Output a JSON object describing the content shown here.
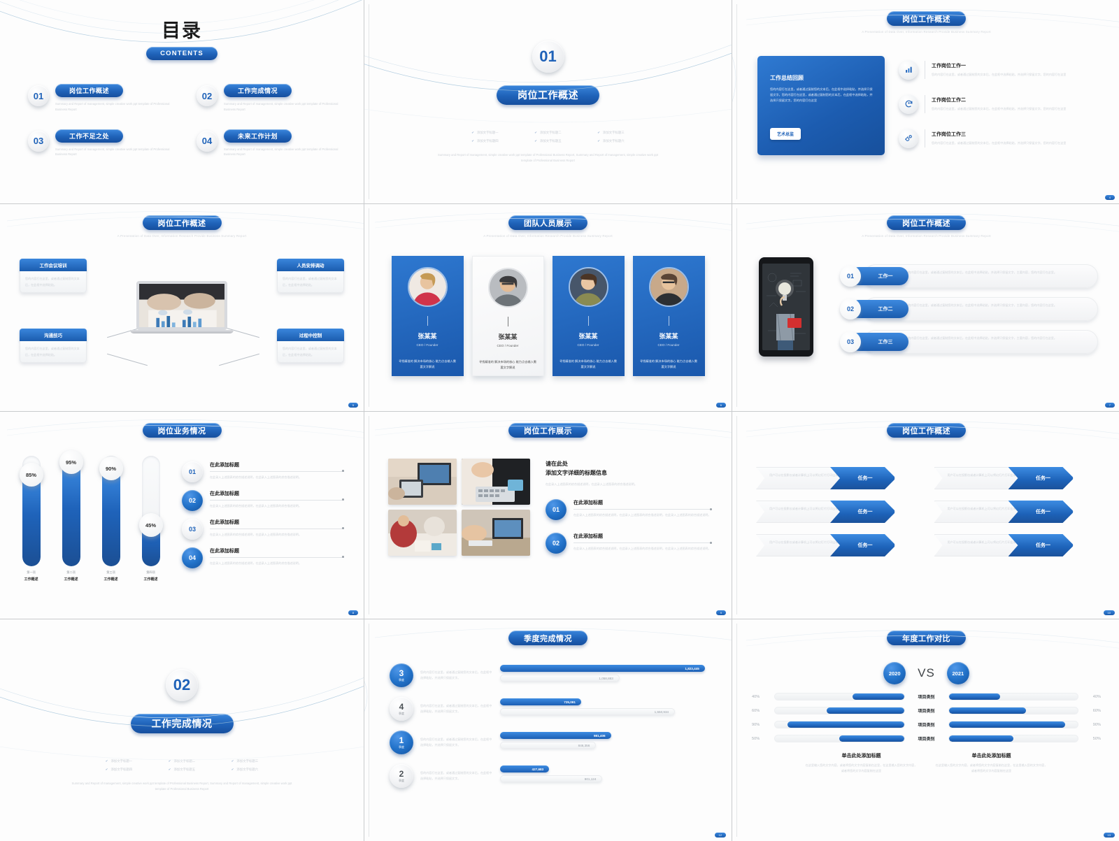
{
  "deck": {
    "accent_blue": "#1f62b8",
    "accent_blue_light": "#3d8ce2",
    "lorem_en": "Summary and Report of management, simple creative work ppt template of Professional Business Report",
    "lorem_cn_short": "您的内容打在这里，或者通过复制您的文本后，在此框中选择粘贴，并选择只保留文字。",
    "lorem_cn_long": "您的内容打在这里，或者通过复制您的文本后，在此框中选择粘贴，并选择只保留文字。您的内容打在这里，或者通过复制您的文本后，在此框中选择粘贴，并选择只保留文字。您的内容打在这里。",
    "lorem_cn_click": "在此录入上述图表的综合描述说明，在此录入上述图表的综合描述说明。",
    "sub_en_line": "A Presentation of Data Over, Information Research Provide Business Summary Report"
  },
  "slide1": {
    "title": "目录",
    "contents_label": "CONTENTS",
    "items": [
      {
        "num": "01",
        "label": "岗位工作概述"
      },
      {
        "num": "02",
        "label": "工作完成情况"
      },
      {
        "num": "03",
        "label": "工作不足之处"
      },
      {
        "num": "04",
        "label": "未来工作计划"
      }
    ]
  },
  "slide2": {
    "number": "01",
    "title": "岗位工作概述",
    "checks": [
      "添加文字标题一",
      "添加文字标题二",
      "添加文字标题三",
      "添加文字标题四",
      "添加文字标题五",
      "添加文字标题六"
    ],
    "footer": "Summary and Report of management, simple creative work ppt template of Professional Business Report, Summary and Report of management, simple creative work ppt template of Professional Business Report"
  },
  "slide3": {
    "title": "岗位工作概述",
    "card": {
      "heading": "工作总结回顾",
      "body": "您的内容打在这里，或者通过复制您的文本后，在此框中选择粘贴，并选择只保留文字。您的内容打在这里，或者通过复制您的文本后，在此框中选择粘贴，并选择只保留文字。您的内容打在这里",
      "button": "艺术总监"
    },
    "rows": [
      {
        "icon": "bar-chart-icon",
        "glyph": "▦",
        "title": "工作岗位工作一",
        "desc": "您的内容打在这里，或者通过复制您的文本后，在此框中选择粘贴，并选择只保留文字。您的内容打在这里"
      },
      {
        "icon": "refresh-user-icon",
        "glyph": "◔",
        "title": "工作岗位工作二",
        "desc": "您的内容打在这里，或者通过复制您的文本后，在此框中选择粘贴，并选择只保留文字。您的内容打在这里"
      },
      {
        "icon": "gears-icon",
        "glyph": "✾",
        "title": "工作岗位工作三",
        "desc": "您的内容打在这里，或者通过复制您的文本后，在此框中选择粘贴，并选择只保留文字。您的内容打在这里"
      }
    ]
  },
  "slide4": {
    "title": "岗位工作概述",
    "boxes": [
      {
        "head": "工作会议培训",
        "body": "您的内容打在这里，或者通过复制您的文本后，在此框中选择粘贴。"
      },
      {
        "head": "人员安排调动",
        "body": "您的内容打在这里，或者通过复制您的文本后，在此框中选择粘贴。"
      },
      {
        "head": "沟通技巧",
        "body": "您的内容打在这里，或者通过复制您的文本后，在此框中选择粘贴。"
      },
      {
        "head": "过程中控制",
        "body": "您的内容打在这里，或者通过复制您的文本后，在此框中选择粘贴。"
      }
    ]
  },
  "slide5": {
    "title": "团队人员展示",
    "members": [
      {
        "name": "张某某",
        "role": "CEO / Founder",
        "desc": "寻找精准的 解决市场的核心 能力点去输入需要文字解说",
        "theme": "blue"
      },
      {
        "name": "张某某",
        "role": "CEO / Founder",
        "desc": "寻找精准的 解决市场的核心 能力点去输入需要文字解说",
        "theme": "light"
      },
      {
        "name": "张某某",
        "role": "CEO / Founder",
        "desc": "寻找精准的 解决市场的核心 能力点去输入需要文字解说",
        "theme": "blue"
      },
      {
        "name": "张某某",
        "role": "CEO / Founder",
        "desc": "寻找精准的 解决市场的核心 能力点去输入需要文字解说",
        "theme": "blue"
      }
    ]
  },
  "slide6": {
    "title": "岗位工作概述",
    "rows": [
      {
        "num": "01",
        "tag": "工作一",
        "desc": "您的内容打在这里，或者通过复制您的文本后，在此框中选择粘贴，并选择只保留文字，主要内容，您的内容打在这里。"
      },
      {
        "num": "02",
        "tag": "工作二",
        "desc": "您的内容打在这里，或者通过复制您的文本后，在此框中选择粘贴，并选择只保留文字，主要内容，您的内容打在这里。"
      },
      {
        "num": "03",
        "tag": "工作三",
        "desc": "您的内容打在这里，或者通过复制您的文本后，在此框中选择粘贴，并选择只保留文字，主要内容，您的内容打在这里。"
      }
    ]
  },
  "slide7": {
    "title": "岗位业务情况",
    "list": [
      {
        "num": "01",
        "title": "在此添加标题",
        "desc": "在此录入上述图表的综合描述说明，在此录入上述图表的综合描述说明。",
        "filled": false
      },
      {
        "num": "02",
        "title": "在此添加标题",
        "desc": "在此录入上述图表的综合描述说明，在此录入上述图表的综合描述说明。",
        "filled": true
      },
      {
        "num": "03",
        "title": "在此添加标题",
        "desc": "在此录入上述图表的综合描述说明，在此录入上述图表的综合描述说明。",
        "filled": false
      },
      {
        "num": "04",
        "title": "在此添加标题",
        "desc": "在此录入上述图表的综合描述说明，在此录入上述图表的综合描述说明。",
        "filled": true
      }
    ],
    "chart_data": {
      "type": "bar",
      "orientation": "vertical",
      "title": "岗位业务情况",
      "categories": [
        "第一项",
        "第二项",
        "第三项",
        "第四项"
      ],
      "category_sublabels": [
        "工作概述",
        "工作概述",
        "工作概述",
        "工作概述"
      ],
      "values": [
        85,
        95,
        90,
        45
      ],
      "value_labels": [
        "85%",
        "95%",
        "90%",
        "45%"
      ],
      "ylim": [
        0,
        100
      ],
      "ylabel": "",
      "xlabel": "",
      "grid": false,
      "legend": "none"
    }
  },
  "slide8": {
    "title": "岗位工作展示",
    "heading_line1": "请在此处",
    "heading_line2": "添加文字详细的标题信息",
    "subtext": "在此录入上述图表的综合描述说明，在此录入上述图表的综合描述说明。",
    "items": [
      {
        "num": "01",
        "title": "在此添加标题",
        "desc": "在此录入上述图表的综合描述说明，在此录入上述图表的综合描述说明，在此录入上述图表的综合描述说明。"
      },
      {
        "num": "02",
        "title": "在此添加标题",
        "desc": "在此录入上述图表的综合描述说明，在此录入上述图表的综合描述说明，在此录入上述图表的综合描述说明。"
      }
    ]
  },
  "slide9": {
    "title": "岗位工作概述",
    "arrows": [
      {
        "desc": "用户可以在投影仪或者计算机上可以将幻灯片打印出来",
        "tag": "任务一"
      },
      {
        "desc": "用户可以在投影仪或者计算机上可以将幻灯片打印出来",
        "tag": "任务一"
      },
      {
        "desc": "用户可以在投影仪或者计算机上可以将幻灯片打印出来",
        "tag": "任务一"
      },
      {
        "desc": "用户可以在投影仪或者计算机上可以将幻灯片打印出来",
        "tag": "任务一"
      },
      {
        "desc": "用户可以在投影仪或者计算机上可以将幻灯片打印出来",
        "tag": "任务一"
      },
      {
        "desc": "用户可以在投影仪或者计算机上可以将幻灯片打印出来",
        "tag": "任务一"
      }
    ]
  },
  "slide10": {
    "number": "02",
    "title": "工作完成情况",
    "checks": [
      "添加文字标题一",
      "添加文字标题二",
      "添加文字标题三",
      "添加文字标题四",
      "添加文字标题五",
      "添加文字标题六"
    ],
    "footer": "Summary and Report of management, simple creative work ppt template of Professional Business Report, Summary and Report of management, simple creative work ppt template of Professional Business Report"
  },
  "slide11": {
    "title": "季度完成情况",
    "unit": "季度",
    "rows": [
      {
        "q": "3",
        "desc": "您的内容打在这里，或者通过复制您的文本后，在此框中选择粘贴，并选择只保留文字。",
        "active": true
      },
      {
        "q": "4",
        "desc": "您的内容打在这里，或者通过复制您的文本后，在此框中选择粘贴，并选择只保留文字。",
        "active": false
      },
      {
        "q": "1",
        "desc": "您的内容打在这里，或者通过复制您的文本后，在此框中选择粘贴，并选择只保留文字。",
        "active": true
      },
      {
        "q": "2",
        "desc": "您的内容打在这里，或者通过复制您的文本后，在此框中选择粘贴，并选择只保留文字。",
        "active": false
      }
    ],
    "chart_data": {
      "type": "bar",
      "orientation": "horizontal",
      "title": "季度完成情况",
      "categories": [
        "3 季度",
        "4 季度",
        "1 季度",
        "2 季度"
      ],
      "series": [
        {
          "name": "本期",
          "values": [
            1823445,
            725091,
            981406,
            427683
          ],
          "labels": [
            "1,823,445",
            "725,091",
            "981,406",
            "427,683"
          ]
        },
        {
          "name": "对比",
          "values": [
            1058883,
            1550934,
            846356,
            901124
          ],
          "labels": [
            "1,058,883",
            "1,550,934",
            "846,356",
            "901,124"
          ]
        }
      ],
      "xlim": [
        0,
        1900000
      ],
      "grid": false,
      "legend": "none"
    }
  },
  "slide12": {
    "title": "年度工作对比",
    "left_year": "2020",
    "right_year": "2021",
    "vs": "VS",
    "footer_left": {
      "title": "单击此处添加标题",
      "desc": "在这里输入您的文字内容，或者将您的文字内容复制在这里，在这里输入您的文字内容，或者将您的文字内容复制在这里"
    },
    "footer_right": {
      "title": "单击此处添加标题",
      "desc": "在这里输入您的文字内容，或者将您的文字内容复制在这里，在这里输入您的文字内容，或者将您的文字内容复制在这里"
    },
    "chart_data": {
      "type": "bar",
      "orientation": "horizontal-diverging",
      "title": "年度工作对比",
      "categories": [
        "项目类别",
        "项目类别",
        "项目类别",
        "项目类别"
      ],
      "series": [
        {
          "name": "2020",
          "values": [
            40,
            60,
            90,
            50
          ],
          "labels": [
            "40%",
            "60%",
            "90%",
            "50%"
          ]
        },
        {
          "name": "2021",
          "values": [
            40,
            60,
            90,
            50
          ],
          "labels": [
            "40%",
            "60%",
            "90%",
            "50%"
          ]
        }
      ],
      "xlim": [
        0,
        100
      ],
      "grid": false,
      "legend": "top"
    }
  },
  "page_numbers": [
    "",
    "",
    "4",
    "5",
    "6",
    "7",
    "8",
    "9",
    "10",
    "11",
    "12",
    "13"
  ]
}
